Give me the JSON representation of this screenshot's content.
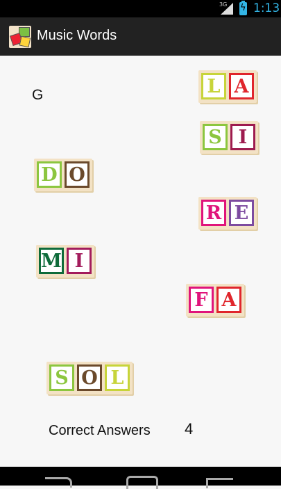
{
  "status_bar": {
    "network": "3G",
    "time": "1:13"
  },
  "action_bar": {
    "title": "Music Words",
    "icon": "app-blocks-icon"
  },
  "note_label": "G",
  "words": [
    {
      "id": "la",
      "letters": [
        {
          "char": "L",
          "color": "#c7d43a"
        },
        {
          "char": "A",
          "color": "#e0262c"
        }
      ]
    },
    {
      "id": "si",
      "letters": [
        {
          "char": "S",
          "color": "#8cc63f"
        },
        {
          "char": "I",
          "color": "#9e1b4f"
        }
      ]
    },
    {
      "id": "do",
      "letters": [
        {
          "char": "D",
          "color": "#8cc63f"
        },
        {
          "char": "O",
          "color": "#6b4a2b"
        }
      ]
    },
    {
      "id": "re",
      "letters": [
        {
          "char": "R",
          "color": "#e0147b"
        },
        {
          "char": "E",
          "color": "#7d4ba0"
        }
      ]
    },
    {
      "id": "mi",
      "letters": [
        {
          "char": "M",
          "color": "#0e6b3a"
        },
        {
          "char": "I",
          "color": "#a31c5c"
        }
      ]
    },
    {
      "id": "fa",
      "letters": [
        {
          "char": "F",
          "color": "#e0147b"
        },
        {
          "char": "A",
          "color": "#e0262c"
        }
      ]
    },
    {
      "id": "sol",
      "letters": [
        {
          "char": "S",
          "color": "#8cc63f"
        },
        {
          "char": "O",
          "color": "#6b4a2b"
        },
        {
          "char": "L",
          "color": "#c7d43a"
        }
      ]
    }
  ],
  "answers": {
    "label": "Correct Answers",
    "count": "4"
  }
}
